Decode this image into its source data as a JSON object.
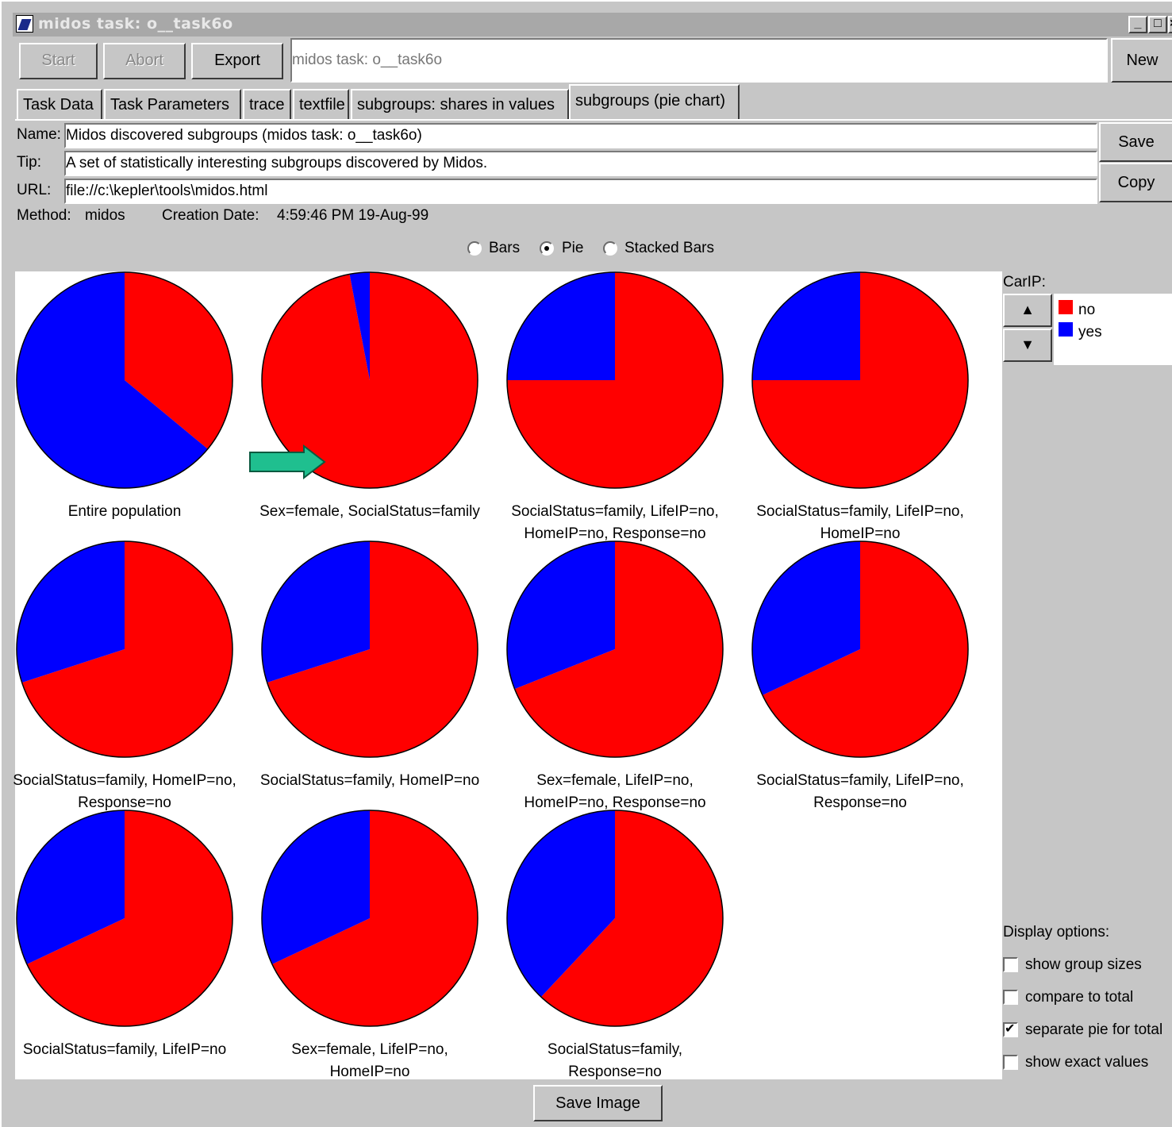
{
  "window": {
    "title": "midos task: o__task6o",
    "controls": [
      "_",
      "□",
      "×"
    ]
  },
  "toolbar": {
    "start_label": "Start",
    "abort_label": "Abort",
    "export_label": "Export",
    "task_field_value": "midos task: o__task6o",
    "new_label": "New"
  },
  "tabs": [
    {
      "label": "Task Data"
    },
    {
      "label": "Task Parameters"
    },
    {
      "label": "trace"
    },
    {
      "label": "textfile"
    },
    {
      "label": "subgroups: shares in values"
    },
    {
      "label": "subgroups (pie chart)",
      "active": true
    }
  ],
  "form": {
    "name_label": "Name:",
    "name_value": "Midos discovered subgroups (midos task: o__task6o)",
    "tip_label": "Tip:",
    "tip_value": "A set of statistically interesting subgroups discovered by Midos.",
    "url_label": "URL:",
    "url_value": "file://c:\\kepler\\tools\\midos.html",
    "method_label": "Method:",
    "method_value": "midos",
    "creation_label": "Creation Date:",
    "creation_value": "4:59:46 PM 19-Aug-99",
    "save_label": "Save",
    "copy_label": "Copy"
  },
  "view_mode": {
    "options": [
      {
        "label": "Bars",
        "selected": false
      },
      {
        "label": "Pie",
        "selected": true
      },
      {
        "label": "Stacked Bars",
        "selected": false
      }
    ]
  },
  "legend": {
    "attribute_label": "CarIP:",
    "up_icon": "triangle-up-icon",
    "down_icon": "triangle-down-icon",
    "items": [
      {
        "label": "no",
        "color": "#ff0000"
      },
      {
        "label": "yes",
        "color": "#0000ff"
      }
    ]
  },
  "display_options": {
    "title": "Display options:",
    "items": [
      {
        "label": "show group sizes",
        "checked": false
      },
      {
        "label": "compare to total",
        "checked": false
      },
      {
        "label": "separate pie for total",
        "checked": true
      },
      {
        "label": "show exact values",
        "checked": false
      }
    ]
  },
  "save_image_label": "Save Image",
  "chart_data": {
    "type": "pie",
    "colors": {
      "no": "#ff0000",
      "yes": "#0000ff"
    },
    "pies": [
      {
        "label_lines": [
          "Entire population"
        ],
        "values": {
          "no": 0.36,
          "yes": 0.64
        }
      },
      {
        "label_lines": [
          "Sex=female, SocialStatus=family"
        ],
        "values": {
          "no": 0.97,
          "yes": 0.03
        }
      },
      {
        "label_lines": [
          "SocialStatus=family, LifeIP=no,",
          "HomeIP=no, Response=no"
        ],
        "values": {
          "no": 0.75,
          "yes": 0.25
        }
      },
      {
        "label_lines": [
          "SocialStatus=family, LifeIP=no,",
          "HomeIP=no"
        ],
        "values": {
          "no": 0.75,
          "yes": 0.25
        }
      },
      {
        "label_lines": [
          "SocialStatus=family, HomeIP=no,",
          "Response=no"
        ],
        "values": {
          "no": 0.7,
          "yes": 0.3
        }
      },
      {
        "label_lines": [
          "SocialStatus=family, HomeIP=no"
        ],
        "values": {
          "no": 0.7,
          "yes": 0.3
        }
      },
      {
        "label_lines": [
          "Sex=female, LifeIP=no,",
          "HomeIP=no, Response=no"
        ],
        "values": {
          "no": 0.69,
          "yes": 0.31
        }
      },
      {
        "label_lines": [
          "SocialStatus=family, LifeIP=no,",
          "Response=no"
        ],
        "values": {
          "no": 0.68,
          "yes": 0.32
        }
      },
      {
        "label_lines": [
          "SocialStatus=family, LifeIP=no"
        ],
        "values": {
          "no": 0.68,
          "yes": 0.32
        }
      },
      {
        "label_lines": [
          "Sex=female, LifeIP=no,",
          "HomeIP=no"
        ],
        "values": {
          "no": 0.68,
          "yes": 0.32
        }
      },
      {
        "label_lines": [
          "SocialStatus=family,",
          "Response=no"
        ],
        "values": {
          "no": 0.62,
          "yes": 0.38
        }
      }
    ]
  }
}
